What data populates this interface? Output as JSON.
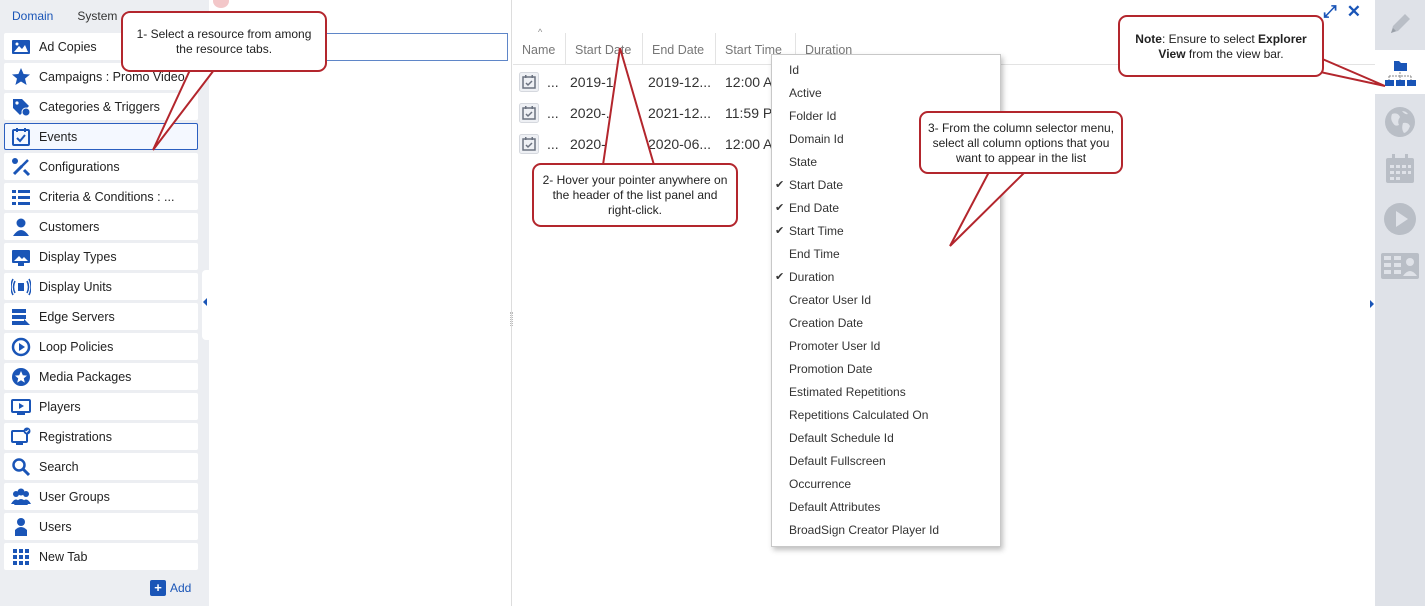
{
  "left_tabs": [
    "Domain",
    "System"
  ],
  "resources": [
    {
      "label": "Ad Copies",
      "icon": "ad-copies-icon"
    },
    {
      "label": "Campaigns : Promo Video",
      "icon": "star-icon"
    },
    {
      "label": "Categories & Triggers",
      "icon": "categories-icon"
    },
    {
      "label": "Events",
      "icon": "calendar-check-icon",
      "active": true
    },
    {
      "label": "Configurations",
      "icon": "tools-icon"
    },
    {
      "label": "Criteria & Conditions : ...",
      "icon": "criteria-icon"
    },
    {
      "label": "Customers",
      "icon": "person-icon"
    },
    {
      "label": "Display Types",
      "icon": "display-types-icon"
    },
    {
      "label": "Display Units",
      "icon": "display-units-icon"
    },
    {
      "label": "Edge Servers",
      "icon": "edge-servers-icon"
    },
    {
      "label": "Loop Policies",
      "icon": "loop-icon"
    },
    {
      "label": "Media Packages",
      "icon": "media-package-icon"
    },
    {
      "label": "Players",
      "icon": "player-icon"
    },
    {
      "label": "Registrations",
      "icon": "registrations-icon"
    },
    {
      "label": "Search",
      "icon": "search-icon"
    },
    {
      "label": "User Groups",
      "icon": "user-groups-icon"
    },
    {
      "label": "Users",
      "icon": "user-icon"
    },
    {
      "label": "New Tab",
      "icon": "grid-icon"
    }
  ],
  "add_label": "Add",
  "list": {
    "columns": [
      "Name",
      "Start Date",
      "End Date",
      "Start Time",
      "Duration"
    ],
    "rows": [
      {
        "name": "...",
        "start_date": "2019-1...",
        "end_date": "2019-12...",
        "start_time": "12:00 AM"
      },
      {
        "name": "...",
        "start_date": "2020-...",
        "end_date": "2021-12...",
        "start_time": "11:59 PM"
      },
      {
        "name": "...",
        "start_date": "2020-...",
        "end_date": "2020-06...",
        "start_time": "12:00 AM"
      }
    ]
  },
  "column_menu": [
    {
      "label": "Id",
      "checked": false
    },
    {
      "label": "Active",
      "checked": false
    },
    {
      "label": "Folder Id",
      "checked": false
    },
    {
      "label": "Domain Id",
      "checked": false
    },
    {
      "label": "State",
      "checked": false
    },
    {
      "label": "Start Date",
      "checked": true
    },
    {
      "label": "End Date",
      "checked": true
    },
    {
      "label": "Start Time",
      "checked": true
    },
    {
      "label": "End Time",
      "checked": false
    },
    {
      "label": "Duration",
      "checked": true
    },
    {
      "label": "Creator User Id",
      "checked": false
    },
    {
      "label": "Creation Date",
      "checked": false
    },
    {
      "label": "Promoter User Id",
      "checked": false
    },
    {
      "label": "Promotion Date",
      "checked": false
    },
    {
      "label": "Estimated Repetitions",
      "checked": false
    },
    {
      "label": "Repetitions Calculated On",
      "checked": false
    },
    {
      "label": "Default Schedule Id",
      "checked": false
    },
    {
      "label": "Default Fullscreen",
      "checked": false
    },
    {
      "label": "Occurrence",
      "checked": false
    },
    {
      "label": "Default Attributes",
      "checked": false
    },
    {
      "label": "BroadSign Creator Player Id",
      "checked": false
    }
  ],
  "view_bar": [
    "pencil-icon",
    "explorer-view-icon",
    "globe-icon",
    "calendar-icon",
    "play-icon",
    "gallery-icon"
  ],
  "callouts": {
    "c1": "1- Select a resource from among the resource tabs.",
    "c2": "2- Hover your pointer anywhere on the header of the list panel and right-click.",
    "c3": "3- From the column selector menu, select all column options that you want to appear in the list",
    "note_bold": "Note",
    "note_text1": ": Ensure to select ",
    "note_bold2": "Explorer View",
    "note_text2": " from the view bar."
  },
  "colors": {
    "accent": "#1a55b7",
    "callout_border": "#b3262d"
  }
}
